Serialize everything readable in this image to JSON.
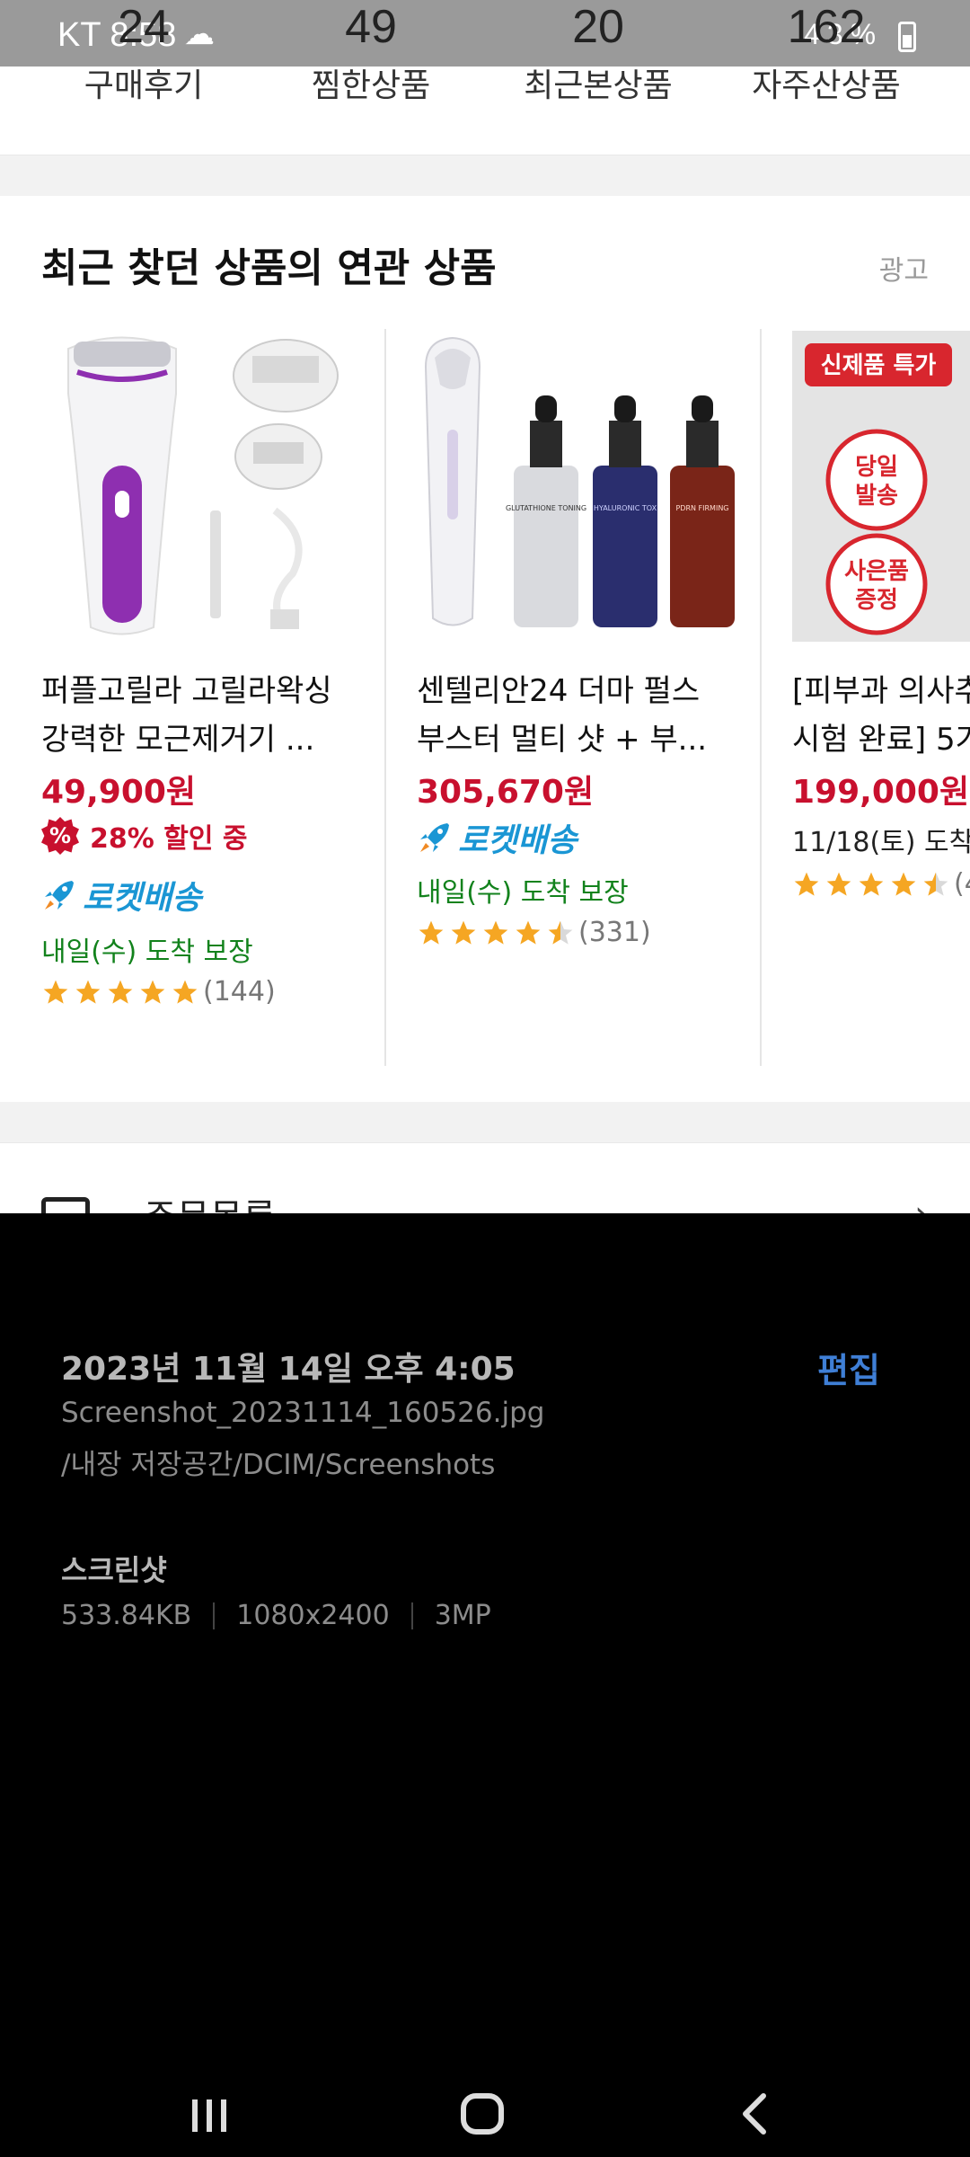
{
  "status_bar": {
    "carrier_time": "KT 8:58",
    "battery": "43%"
  },
  "activity_counts": [
    {
      "count": "24",
      "label": "구매후기"
    },
    {
      "count": "49",
      "label": "찜한상품"
    },
    {
      "count": "20",
      "label": "최근본상품"
    },
    {
      "count": "162",
      "label": "자주산상품"
    }
  ],
  "section": {
    "title": "최근 찾던 상품의 연관 상품",
    "ad_label": "광고"
  },
  "products": [
    {
      "name_line1": "퍼플고릴라 고릴라왁싱",
      "name_line2": "강력한 모근제거기 ...",
      "price": "49,900원",
      "discount": "28% 할인 중",
      "discount_badge": "%",
      "shipping": "로켓배송",
      "arrival": "내일(수) 도착 보장",
      "rating": 5.0,
      "reviews": "(144)"
    },
    {
      "name_line1": "센텔리안24 더마 펄스",
      "name_line2": "부스터 멀티 샷 + 부...",
      "price": "305,670원",
      "shipping": "로켓배송",
      "arrival": "내일(수) 도착 보장",
      "rating": 4.5,
      "reviews": "(331)",
      "bottle_labels": [
        "GLUTATHIONE TONING",
        "HYALURONIC TOX",
        "PDRN FIRMING"
      ]
    },
    {
      "name_line1": "[피부과 의사추",
      "name_line2": "시험 완료] 5가",
      "price": "199,000원",
      "arrival": "11/18(토) 도착",
      "rating": 4.5,
      "reviews": "(4",
      "promo_tag": "신제품 특가",
      "promo_circle1": [
        "당일",
        "발송"
      ],
      "promo_circle2": [
        "사은품",
        "증정"
      ]
    }
  ],
  "order_row": {
    "label": "주문목록"
  },
  "info_panel": {
    "datetime": "2023년 11월 14일 오후 4:05",
    "edit_label": "편집",
    "filename": "Screenshot_20231114_160526.jpg",
    "path": "/내장 저장공간/DCIM/Screenshots",
    "kind": "스크린샷",
    "size": "533.84KB",
    "dimensions": "1080x2400",
    "megapixels": "3MP"
  },
  "colors": {
    "price_red": "#c8102e",
    "rocket_blue": "#1a96d4",
    "arrival_green": "#12821c",
    "star_yellow": "#f5a623",
    "edit_blue": "#3f7fd6"
  },
  "icons": {
    "status_cloud": "cloud-icon",
    "status_right": "status-icons",
    "nav_recent": "recent-apps-icon",
    "nav_home": "home-icon",
    "nav_back": "back-icon"
  }
}
